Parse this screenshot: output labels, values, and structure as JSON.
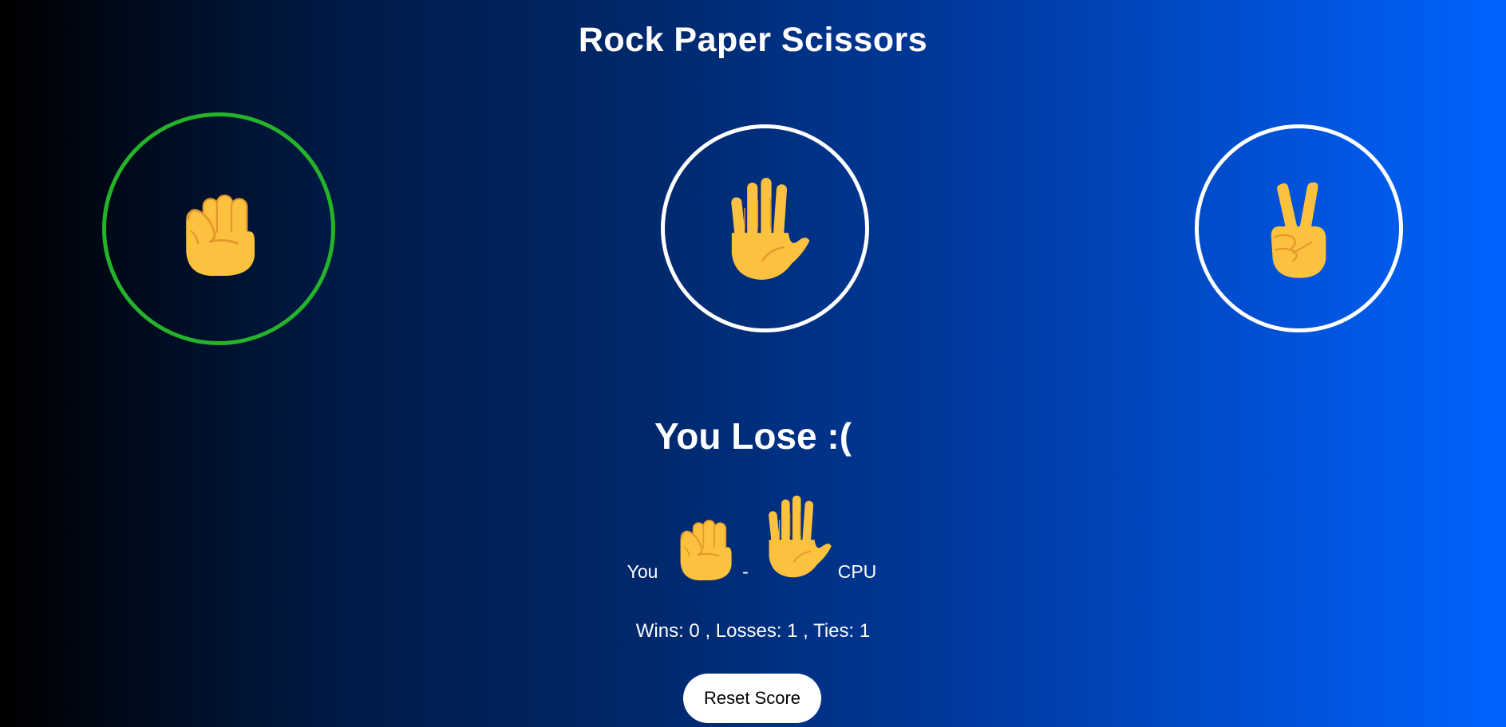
{
  "title": "Rock Paper Scissors",
  "choices": [
    {
      "name": "rock",
      "icon": "raised-fist-icon",
      "selected": true
    },
    {
      "name": "paper",
      "icon": "raised-hand-icon",
      "selected": false
    },
    {
      "name": "scissors",
      "icon": "victory-hand-icon",
      "selected": false
    }
  ],
  "result": "You Lose :(",
  "matchup": {
    "you_label": "You",
    "separator": "-",
    "cpu_label": "CPU",
    "you_pick": "raised-fist-icon",
    "cpu_pick": "raised-hand-icon"
  },
  "score_text": "Wins: 0 , Losses: 1 , Ties: 1",
  "score": {
    "wins": 0,
    "losses": 1,
    "ties": 1
  },
  "reset_label": "Reset Score",
  "colors": {
    "selected_ring": "#25b32a",
    "ring": "#ffffff",
    "hand_fill": "#fcc13e",
    "hand_line": "#e3962a",
    "gradient_start": "#000000",
    "gradient_end": "#0063ff"
  }
}
